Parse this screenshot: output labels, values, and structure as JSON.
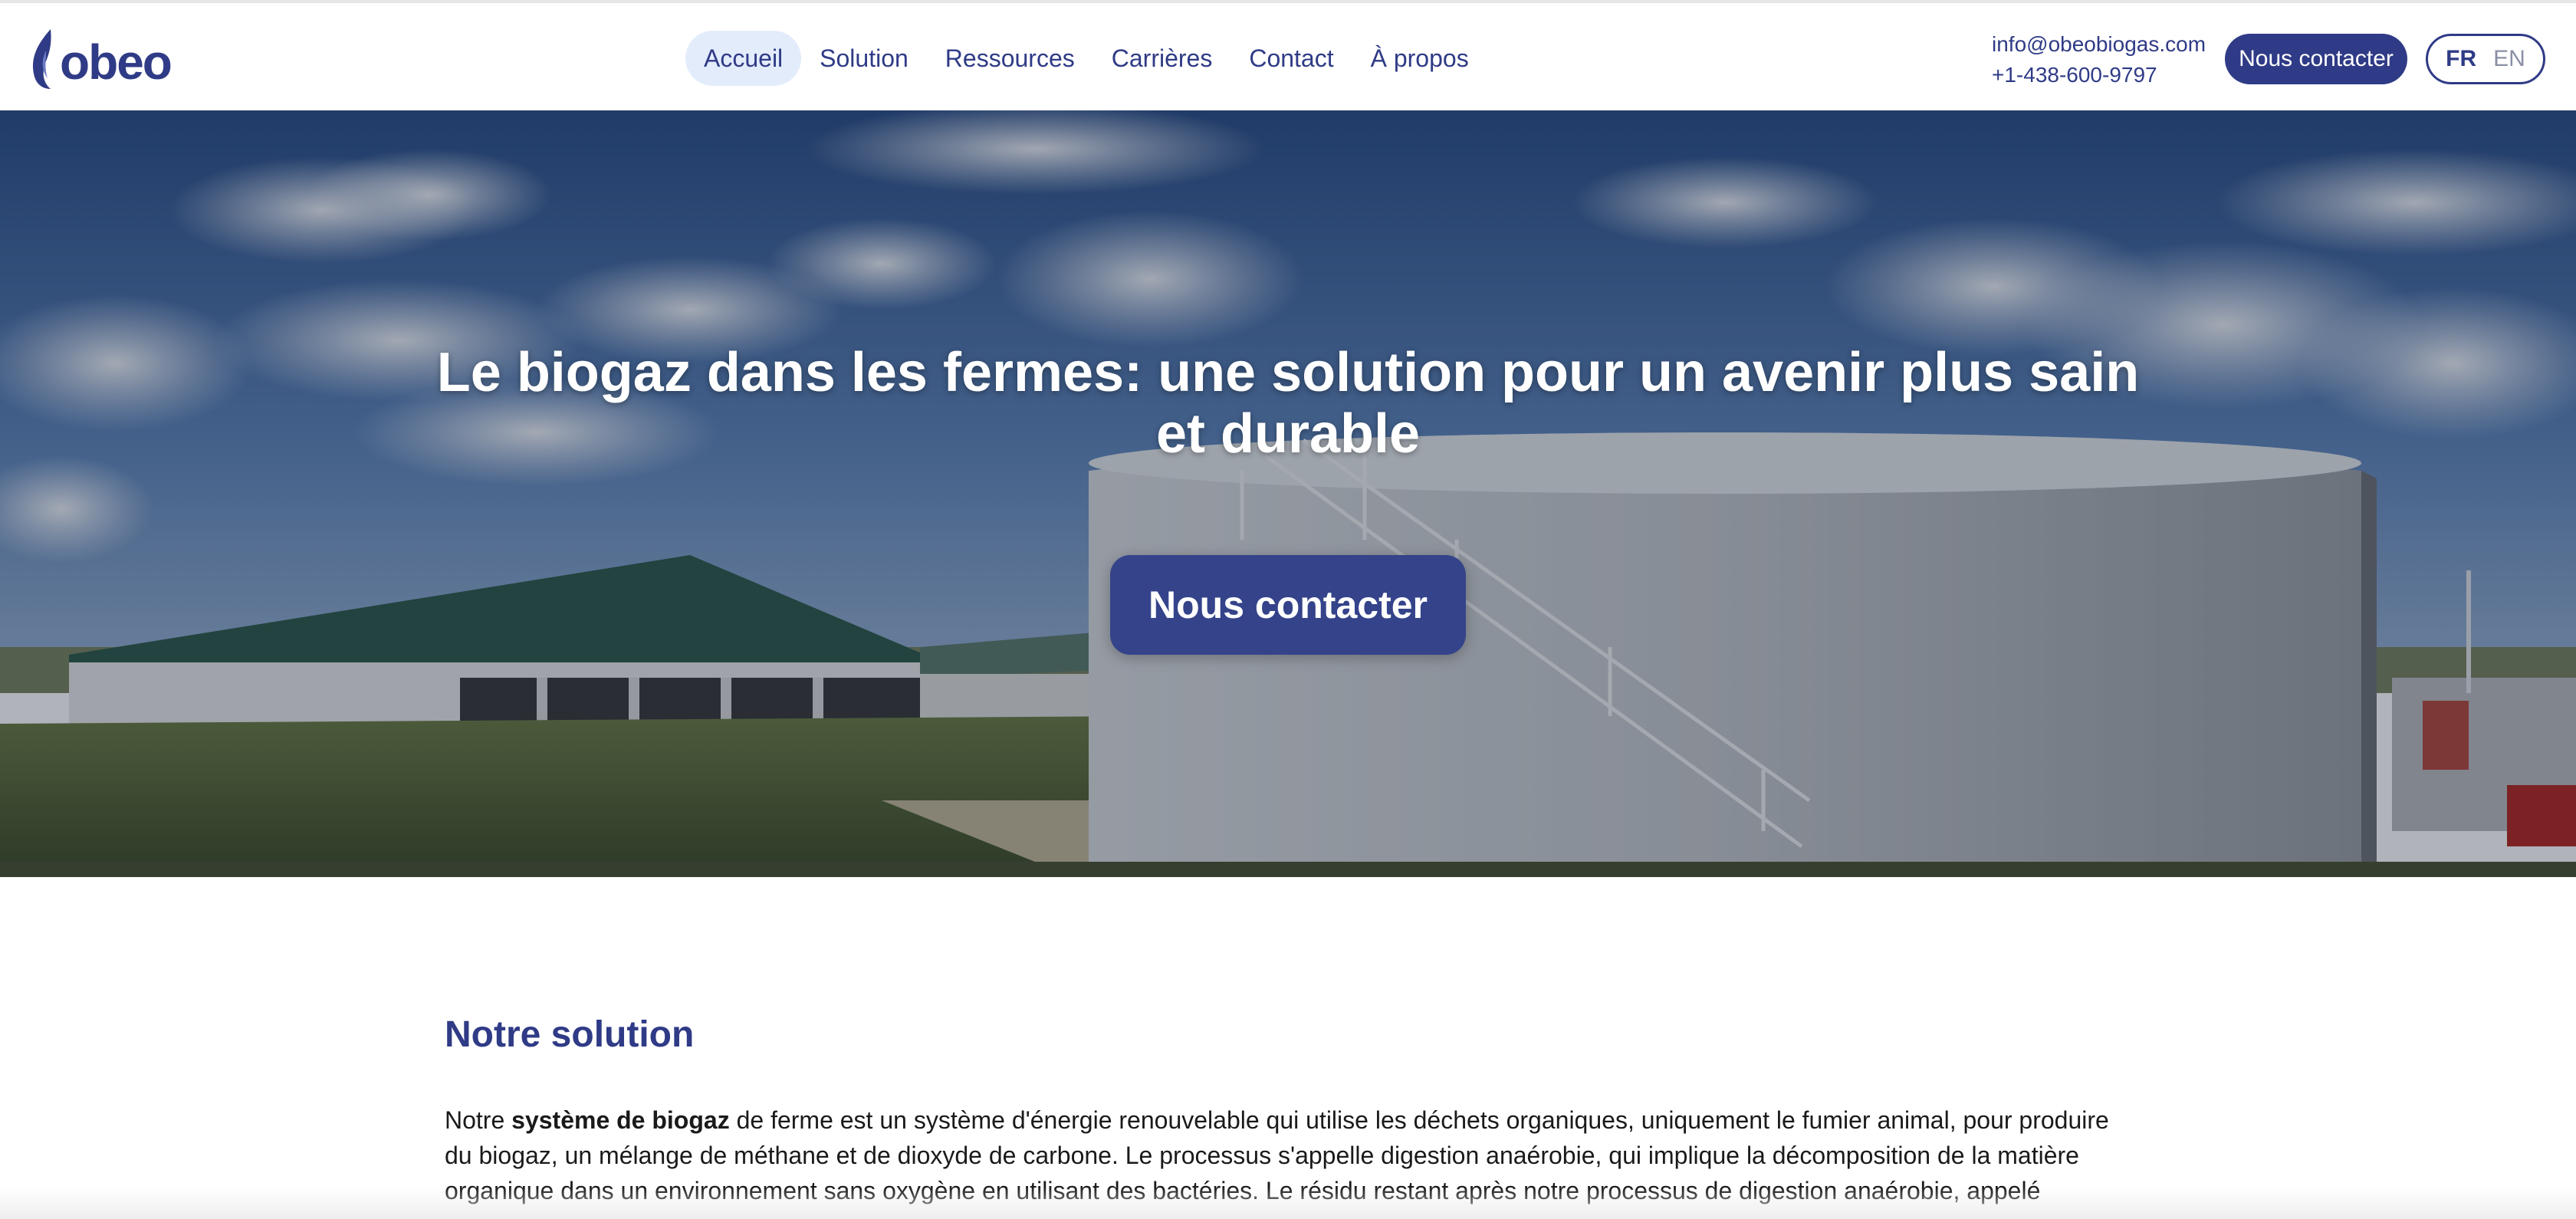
{
  "brand": {
    "logo_text": "obeo",
    "color": "#2f3b86"
  },
  "nav": {
    "items": [
      {
        "label": "Accueil",
        "active": true
      },
      {
        "label": "Solution",
        "active": false
      },
      {
        "label": "Ressources",
        "active": false
      },
      {
        "label": "Carrières",
        "active": false
      },
      {
        "label": "Contact",
        "active": false
      },
      {
        "label": "À propos",
        "active": false
      }
    ]
  },
  "contact": {
    "email": "info@obeobiogas.com",
    "phone": "+1-438-600-9797"
  },
  "header": {
    "cta_label": "Nous contacter"
  },
  "lang": {
    "fr": "FR",
    "en": "EN",
    "selected": "FR"
  },
  "hero": {
    "title": "Le biogaz dans les fermes: une solution pour un avenir plus sain et durable",
    "cta_label": "Nous contacter"
  },
  "solution": {
    "title": "Notre solution",
    "text_before": "Notre ",
    "text_bold": "système de biogaz",
    "text_after": " de ferme est un système d'énergie renouvelable qui utilise les déchets organiques, uniquement le fumier animal, pour produire du biogaz, un mélange de méthane et de dioxyde de carbone. Le processus s'appelle digestion anaérobie, qui implique la décomposition de la matière organique dans un environnement sans oxygène en utilisant des bactéries. Le résidu restant après notre processus de digestion anaérobie, appelé"
  },
  "colors": {
    "primary": "#2f3b86",
    "active_nav_bg": "#e3ecfb",
    "hero_button": "#34438a"
  }
}
